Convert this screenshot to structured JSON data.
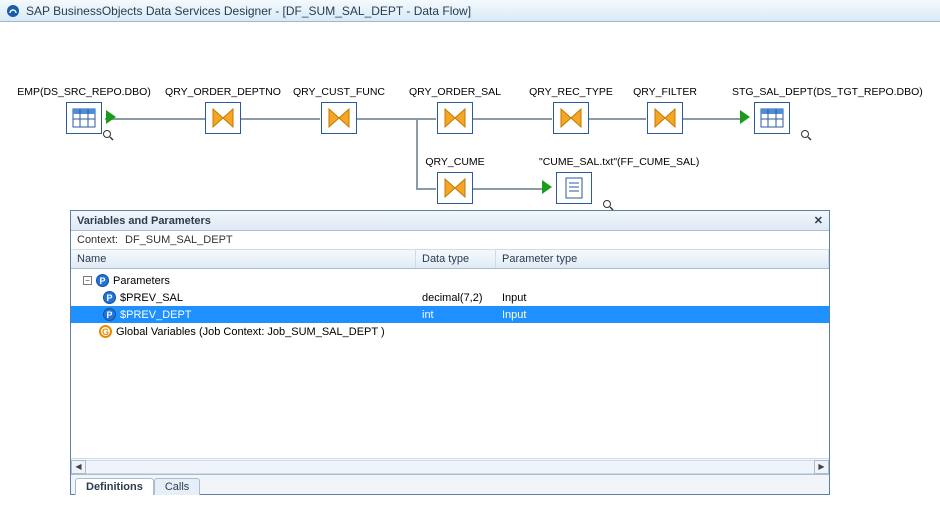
{
  "window_title": "SAP BusinessObjects Data Services Designer - [DF_SUM_SAL_DEPT - Data Flow]",
  "nodes": {
    "src": {
      "label": "EMP(DS_SRC_REPO.DBO)"
    },
    "q1": {
      "label": "QRY_ORDER_DEPTNO"
    },
    "q2": {
      "label": "QRY_CUST_FUNC"
    },
    "q3": {
      "label": "QRY_ORDER_SAL"
    },
    "q4": {
      "label": "QRY_REC_TYPE"
    },
    "q5": {
      "label": "QRY_FILTER"
    },
    "tgt": {
      "label": "STG_SAL_DEPT(DS_TGT_REPO.DBO)"
    },
    "qcume": {
      "label": "QRY_CUME"
    },
    "fcume": {
      "label": "\"CUME_SAL.txt\"(FF_CUME_SAL)"
    }
  },
  "panel": {
    "title": "Variables and Parameters",
    "context_label": "Context:",
    "context_value": "DF_SUM_SAL_DEPT",
    "columns": {
      "name": "Name",
      "type": "Data type",
      "ptype": "Parameter type"
    },
    "tree": {
      "parameters_label": "Parameters",
      "rows": [
        {
          "name": "$PREV_SAL",
          "type": "decimal(7,2)",
          "ptype": "Input",
          "selected": false
        },
        {
          "name": "$PREV_DEPT",
          "type": "int",
          "ptype": "Input",
          "selected": true
        }
      ],
      "globals_label": "Global Variables (Job Context: Job_SUM_SAL_DEPT )"
    },
    "tabs": {
      "def": "Definitions",
      "calls": "Calls"
    }
  }
}
